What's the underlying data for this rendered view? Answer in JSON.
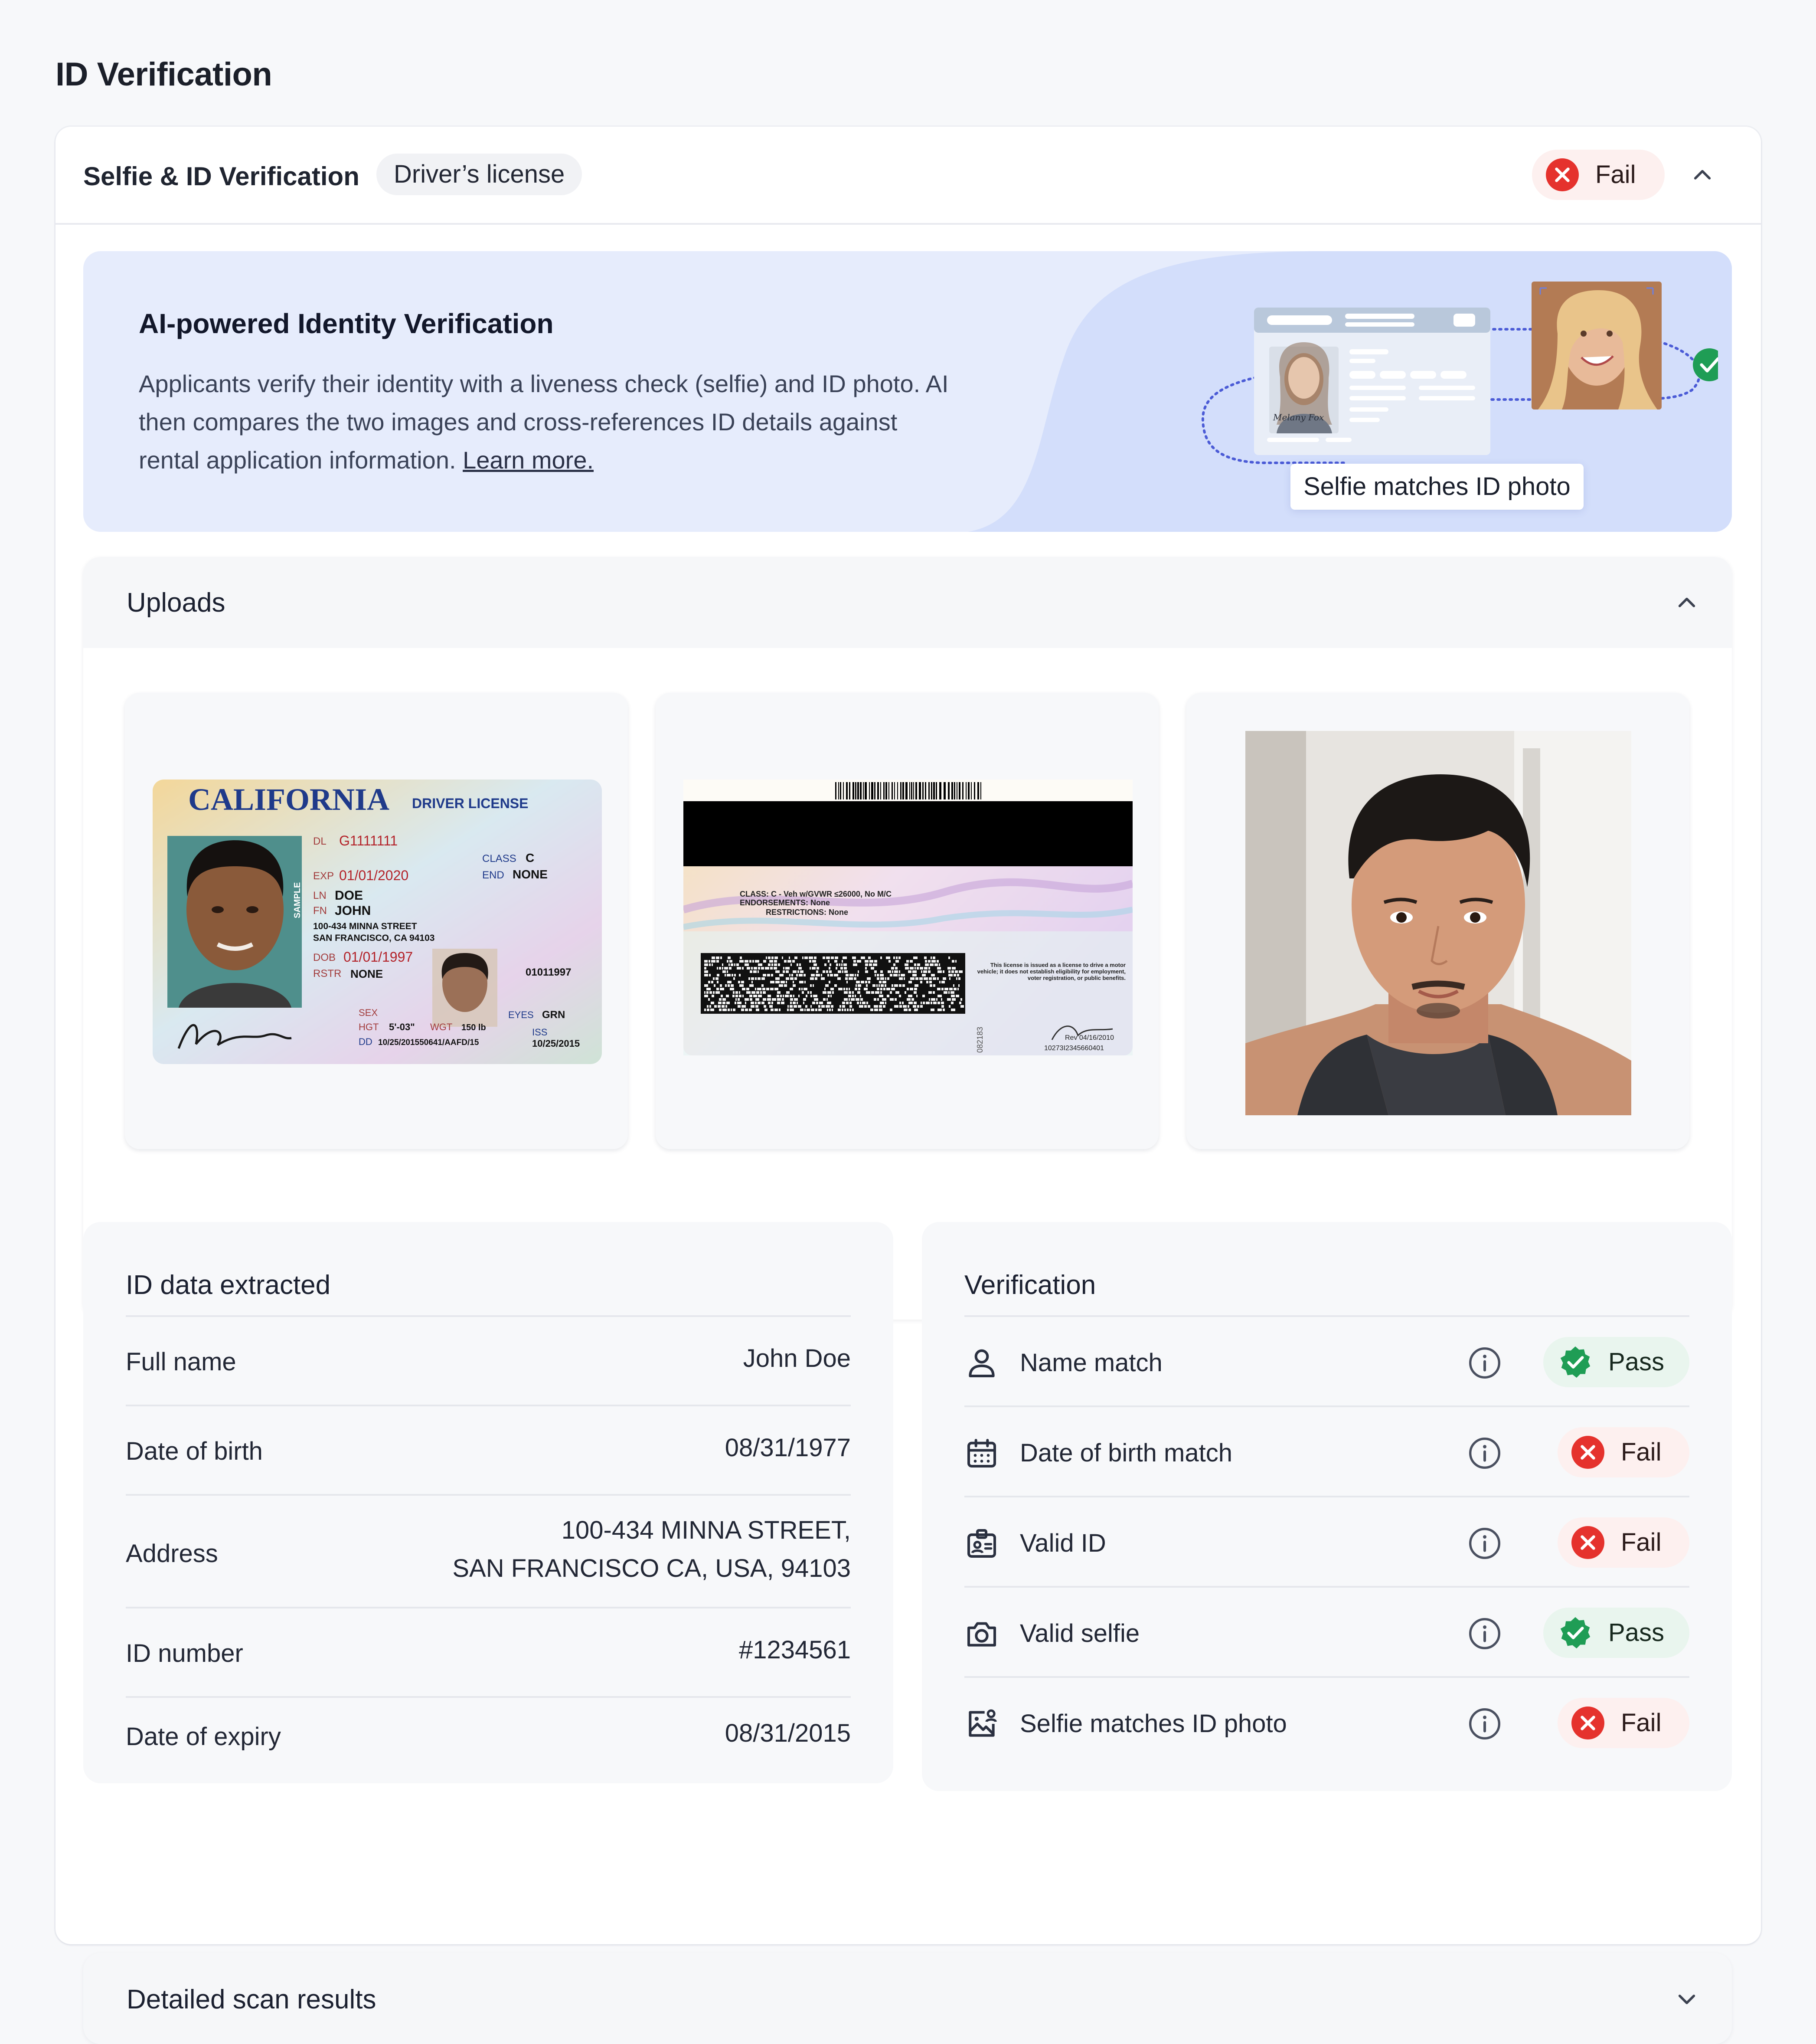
{
  "page": {
    "title": "ID Verification"
  },
  "card": {
    "title": "Selfie & ID Verification",
    "document_type": "Driver’s license",
    "overall_status": "Fail"
  },
  "banner": {
    "title": "AI-powered Identity Verification",
    "text": "Applicants verify their identity with a liveness check (selfie) and ID photo. AI then compares the two images and cross-references ID details against rental application information.",
    "link": "Learn more.",
    "illustration_caption": "Selfie matches ID photo",
    "illustration_card_name": "Melany Fox"
  },
  "uploads": {
    "title": "Uploads",
    "license_front": {
      "state": "CALIFORNIA",
      "type": "DRIVER LICENSE",
      "dl": "G1111111",
      "exp": "01/01/2020",
      "ln": "DOE",
      "fn": "JOHN",
      "address1": "100-434 MINNA STREET",
      "address2": "SAN FRANCISCO, CA 94103",
      "dob": "01/01/1997",
      "rstr": "NONE",
      "class": "C",
      "end": "NONE",
      "sex_label": "SEX",
      "hgt": "5'-03\"",
      "wgt": "150 lb",
      "eyes": "GRN",
      "dd": "10/25/201550641/AAFD/15",
      "iss": "10/25/2015",
      "dob_small": "01011997",
      "sample": "SAMPLE",
      "signature": "B.Oatt"
    },
    "license_back": {
      "class_line": "CLASS: C - Veh w/GVWR ≤26000, No M/C",
      "endorsements": "ENDORSEMENTS: None",
      "restrictions": "RESTRICTIONS: None",
      "notice": "This license is issued as a license to drive a motor vehicle; it does not establish eligibility for employment, voter registration, or public benefits.",
      "rev": "Rev 04/16/2010",
      "serial": "10273I2345660401",
      "side_number": "082183"
    }
  },
  "id_data": {
    "title": "ID data extracted",
    "rows": [
      {
        "label": "Full name",
        "value": "John Doe"
      },
      {
        "label": "Date of birth",
        "value": "08/31/1977"
      },
      {
        "label": "Address",
        "value_line1": "100-434 MINNA STREET,",
        "value_line2": "SAN FRANCISCO CA, USA, 94103"
      },
      {
        "label": "ID number",
        "value": "#1234561"
      },
      {
        "label": "Date of expiry",
        "value": "08/31/2015"
      }
    ]
  },
  "verification": {
    "title": "Verification",
    "rows": [
      {
        "label": "Name match",
        "status": "Pass",
        "icon": "user-icon"
      },
      {
        "label": "Date of birth match",
        "status": "Fail",
        "icon": "calendar-icon"
      },
      {
        "label": "Valid ID",
        "status": "Fail",
        "icon": "id-badge-icon"
      },
      {
        "label": "Valid selfie",
        "status": "Pass",
        "icon": "camera-icon"
      },
      {
        "label": "Selfie matches ID photo",
        "status": "Fail",
        "icon": "image-user-icon"
      }
    ]
  },
  "detailed": {
    "title": "Detailed scan results"
  },
  "colors": {
    "fail_red": "#e5322d",
    "pass_green": "#1f9d55",
    "banner_bg": "#e6ecfc",
    "accent_blue": "#4b5bd6"
  }
}
